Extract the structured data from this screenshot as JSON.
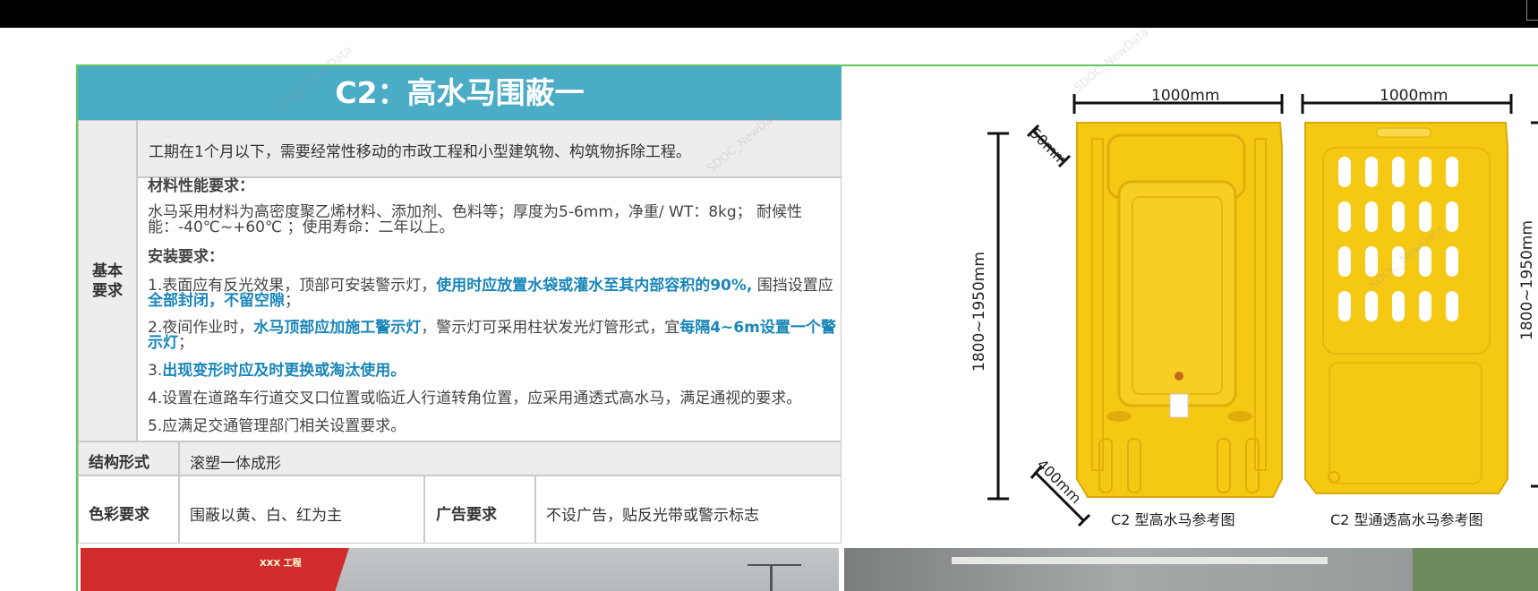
{
  "title": "C2：高水马围蔽一",
  "basic_label": "基本\n要求",
  "usage": "工期在1个月以下，需要经常性移动的市政工程和小型建筑物、构筑物拆除工程。",
  "material": {
    "heading": "材料性能要求：",
    "text": "水马采用材料为高密度聚乙烯材料、添加剂、色料等；厚度为5-6mm，净重/ WT：8kg； 耐候性能：-40℃~+60℃ ；使用寿命：二年以上。"
  },
  "install": {
    "heading": "安装要求：",
    "item1_a": "1.表面应有反光效果，顶部可安装警示灯，",
    "item1_b": "使用时应放置水袋或灌水至其内部容积的90%,",
    "item1_c": " 围挡设置应",
    "item1_d": "全部封闭，不留空隙",
    "item1_e": "；",
    "item2_a": "2.夜间作业时，",
    "item2_b": "水马顶部应加施工警示灯",
    "item2_c": "，警示灯可采用柱状发光灯管形式，宜",
    "item2_d": "每隔4~6m设置一个警示灯",
    "item2_e": "；",
    "item3_a": "3.",
    "item3_b": "出现变形时应及时更换或淘汰使用。",
    "item4": "4.设置在道路车行道交叉口位置或临近人行道转角位置，应采用通透式高水马，满足通视的要求。",
    "item5": "5.应满足交通管理部门相关设置要求。"
  },
  "structure": {
    "label": "结构形式",
    "value": "滚塑一体成形"
  },
  "color": {
    "label": "色彩要求",
    "value": "围蔽以黄、白、红为主"
  },
  "ads": {
    "label": "广告要求",
    "value": "不设广告，贴反光带或警示标志"
  },
  "diagram": {
    "width_label_1": "1000mm",
    "width_label_2": "1000mm",
    "top_thickness": "50mm",
    "base_depth": "400mm",
    "height_left": "1800~1950mm",
    "height_right": "1800~1950mm",
    "caption_1": "C2 型高水马参考图",
    "caption_2": "C2 型通透高水马参考图"
  },
  "banner_text": "XXX 工程",
  "watermark": "SDOC_NewData",
  "colors": {
    "header": "#4bacc6",
    "highlight": "#1a86b8",
    "barrier": "#f5c814",
    "frame": "#5ec85e"
  }
}
